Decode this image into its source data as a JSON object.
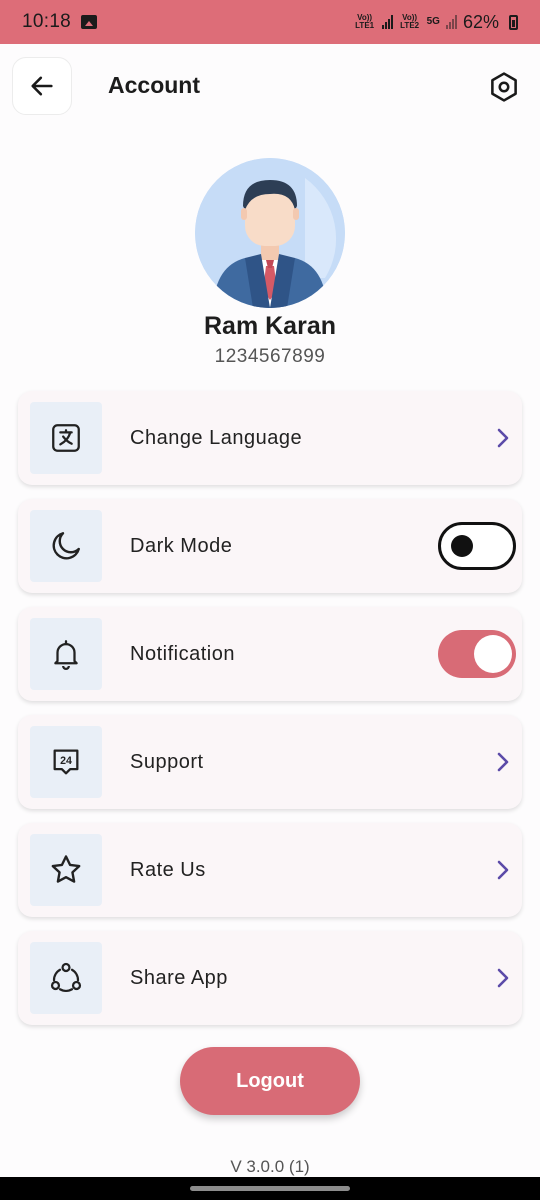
{
  "status_bar": {
    "time": "10:18",
    "sim1_label": "Vo)) LTE1",
    "sim2_label": "Vo)) LTE2",
    "network": "5G",
    "battery": "62%"
  },
  "header": {
    "title": "Account"
  },
  "profile": {
    "name": "Ram Karan",
    "phone": "1234567899"
  },
  "menu": {
    "items": [
      {
        "label": "Change Language",
        "icon": "translate-icon",
        "control": "chevron"
      },
      {
        "label": "Dark Mode",
        "icon": "moon-icon",
        "control": "toggle",
        "on": false
      },
      {
        "label": "Notification",
        "icon": "bell-icon",
        "control": "toggle",
        "on": true
      },
      {
        "label": "Support",
        "icon": "support-24-icon",
        "control": "chevron"
      },
      {
        "label": "Rate Us",
        "icon": "star-icon",
        "control": "chevron"
      },
      {
        "label": "Share App",
        "icon": "share-icon",
        "control": "chevron"
      }
    ]
  },
  "logout_label": "Logout",
  "version": "V 3.0.0 (1)",
  "colors": {
    "accent": "#d86b76",
    "status_bar": "#dd6d78",
    "chevron": "#5b4aa8",
    "icon_box": "#e9eff7"
  }
}
